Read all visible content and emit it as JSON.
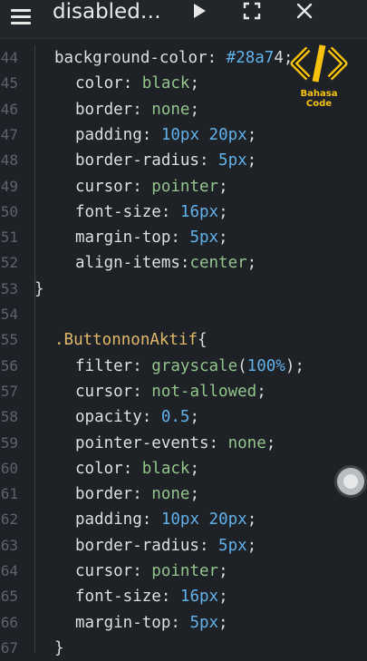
{
  "header": {
    "title": "disabled…",
    "icons": [
      "menu-icon",
      "play-icon",
      "fullscreen-icon",
      "close-icon"
    ]
  },
  "watermark": {
    "text": "Bahasa Code",
    "color": "#f6c20e"
  },
  "editor": {
    "lines": [
      {
        "n": "44",
        "indent": 1,
        "parts": [
          [
            "prop",
            "background-color"
          ],
          [
            "pun",
            ": "
          ],
          [
            "val-hex",
            "#28a7"
          ],
          [
            "pun",
            "4"
          ],
          [
            "pun",
            ";"
          ]
        ]
      },
      {
        "n": "45",
        "indent": 2,
        "parts": [
          [
            "prop",
            "color"
          ],
          [
            "pun",
            ": "
          ],
          [
            "val-str",
            "black"
          ],
          [
            "pun",
            ";"
          ]
        ]
      },
      {
        "n": "46",
        "indent": 2,
        "parts": [
          [
            "prop",
            "border"
          ],
          [
            "pun",
            ": "
          ],
          [
            "val-str",
            "none"
          ],
          [
            "pun",
            ";"
          ]
        ]
      },
      {
        "n": "47",
        "indent": 2,
        "parts": [
          [
            "prop",
            "padding"
          ],
          [
            "pun",
            ": "
          ],
          [
            "val-num",
            "10px"
          ],
          [
            "pun",
            " "
          ],
          [
            "val-num",
            "20px"
          ],
          [
            "pun",
            ";"
          ]
        ]
      },
      {
        "n": "48",
        "indent": 2,
        "parts": [
          [
            "prop",
            "border-radius"
          ],
          [
            "pun",
            ": "
          ],
          [
            "val-num",
            "5px"
          ],
          [
            "pun",
            ";"
          ]
        ]
      },
      {
        "n": "49",
        "indent": 2,
        "parts": [
          [
            "prop",
            "cursor"
          ],
          [
            "pun",
            ": "
          ],
          [
            "val-str",
            "pointer"
          ],
          [
            "pun",
            ";"
          ]
        ]
      },
      {
        "n": "50",
        "indent": 2,
        "parts": [
          [
            "prop",
            "font-size"
          ],
          [
            "pun",
            ": "
          ],
          [
            "val-num",
            "16px"
          ],
          [
            "pun",
            ";"
          ]
        ]
      },
      {
        "n": "51",
        "indent": 2,
        "parts": [
          [
            "prop",
            "margin-top"
          ],
          [
            "pun",
            ": "
          ],
          [
            "val-num",
            "5px"
          ],
          [
            "pun",
            ";"
          ]
        ]
      },
      {
        "n": "52",
        "indent": 2,
        "parts": [
          [
            "prop",
            "align-items"
          ],
          [
            "pun",
            ":"
          ],
          [
            "val-str",
            "center"
          ],
          [
            "pun",
            ";"
          ]
        ]
      },
      {
        "n": "53",
        "indent": 0,
        "parts": [
          [
            "pun",
            "}"
          ]
        ]
      },
      {
        "n": "54",
        "indent": 0,
        "parts": []
      },
      {
        "n": "55",
        "indent": 1,
        "parts": [
          [
            "sel",
            ".ButtonnonAktif"
          ],
          [
            "pun",
            "{"
          ]
        ]
      },
      {
        "n": "56",
        "indent": 2,
        "parts": [
          [
            "prop",
            "filter"
          ],
          [
            "pun",
            ": "
          ],
          [
            "val-str",
            "grayscale"
          ],
          [
            "pun",
            "("
          ],
          [
            "val-num",
            "100%"
          ],
          [
            "pun",
            ");"
          ]
        ]
      },
      {
        "n": "57",
        "indent": 2,
        "parts": [
          [
            "prop",
            "cursor"
          ],
          [
            "pun",
            ": "
          ],
          [
            "val-str",
            "not-allowed"
          ],
          [
            "pun",
            ";"
          ]
        ]
      },
      {
        "n": "58",
        "indent": 2,
        "parts": [
          [
            "prop",
            "opacity"
          ],
          [
            "pun",
            ": "
          ],
          [
            "val-num",
            "0.5"
          ],
          [
            "pun",
            ";"
          ]
        ]
      },
      {
        "n": "59",
        "indent": 2,
        "parts": [
          [
            "prop",
            "pointer-events"
          ],
          [
            "pun",
            ": "
          ],
          [
            "val-str",
            "none"
          ],
          [
            "pun",
            ";"
          ]
        ]
      },
      {
        "n": "60",
        "indent": 2,
        "parts": [
          [
            "prop",
            "color"
          ],
          [
            "pun",
            ": "
          ],
          [
            "val-str",
            "black"
          ],
          [
            "pun",
            ";"
          ]
        ]
      },
      {
        "n": "61",
        "indent": 2,
        "parts": [
          [
            "prop",
            "border"
          ],
          [
            "pun",
            ": "
          ],
          [
            "val-str",
            "none"
          ],
          [
            "pun",
            ";"
          ]
        ]
      },
      {
        "n": "62",
        "indent": 2,
        "parts": [
          [
            "prop",
            "padding"
          ],
          [
            "pun",
            ": "
          ],
          [
            "val-num",
            "10px"
          ],
          [
            "pun",
            " "
          ],
          [
            "val-num",
            "20px"
          ],
          [
            "pun",
            ";"
          ]
        ]
      },
      {
        "n": "63",
        "indent": 2,
        "parts": [
          [
            "prop",
            "border-radius"
          ],
          [
            "pun",
            ": "
          ],
          [
            "val-num",
            "5px"
          ],
          [
            "pun",
            ";"
          ]
        ]
      },
      {
        "n": "64",
        "indent": 2,
        "parts": [
          [
            "prop",
            "cursor"
          ],
          [
            "pun",
            ": "
          ],
          [
            "val-str",
            "pointer"
          ],
          [
            "pun",
            ";"
          ]
        ]
      },
      {
        "n": "65",
        "indent": 2,
        "parts": [
          [
            "prop",
            "font-size"
          ],
          [
            "pun",
            ": "
          ],
          [
            "val-num",
            "16px"
          ],
          [
            "pun",
            ";"
          ]
        ]
      },
      {
        "n": "66",
        "indent": 2,
        "parts": [
          [
            "prop",
            "margin-top"
          ],
          [
            "pun",
            ": "
          ],
          [
            "val-num",
            "5px"
          ],
          [
            "pun",
            ";"
          ]
        ]
      },
      {
        "n": "67",
        "indent": 1,
        "parts": [
          [
            "pun",
            "}"
          ]
        ]
      }
    ]
  }
}
